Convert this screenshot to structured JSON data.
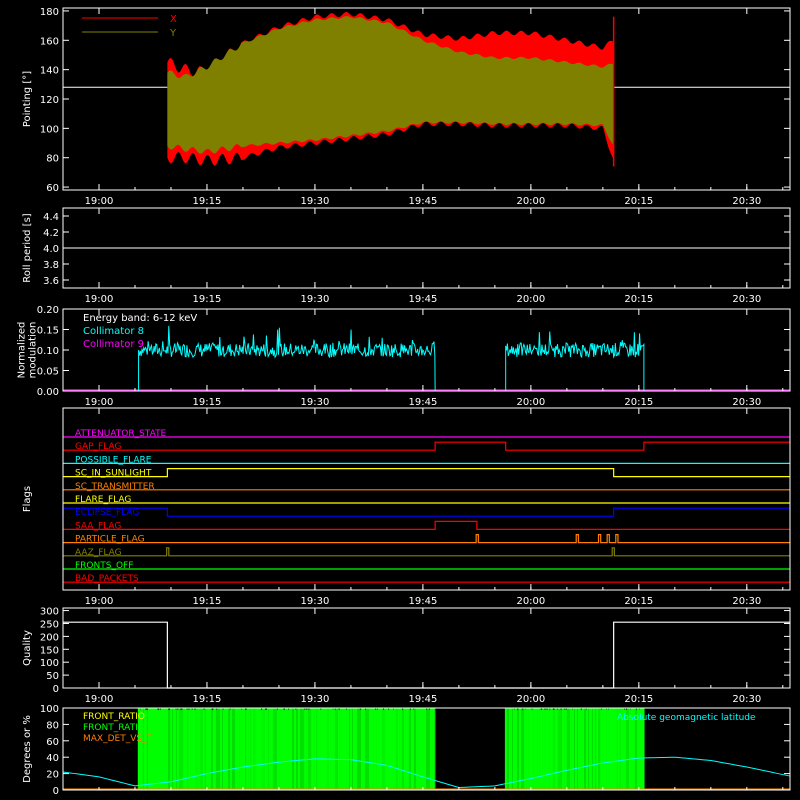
{
  "colors": {
    "background": "#000000",
    "axis": "#ffffff",
    "x_pointing": "#ff0000",
    "y_pointing": "#808000",
    "collimator8": "#00ffff",
    "collimator9": "#ff00ff",
    "magenta": "#ff00ff",
    "red": "#ff0000",
    "cyan": "#00ffff",
    "yellow": "#ffff00",
    "orange": "#ff8000",
    "blue": "#0000ff",
    "olive": "#808000",
    "green": "#00ff00",
    "white": "#ffffff"
  },
  "chart_data": [
    {
      "id": "pointing",
      "type": "area",
      "ylabel": "Pointing [°]",
      "ylim": [
        58,
        182
      ],
      "yticks": [
        60,
        80,
        100,
        120,
        140,
        160,
        180
      ],
      "xlim": [
        1135,
        1236
      ],
      "xticks": [
        "19:00",
        "19:15",
        "19:30",
        "19:45",
        "20:00",
        "20:15",
        "20:30"
      ],
      "xtick_minutes": [
        1140,
        1155,
        1170,
        1185,
        1200,
        1215,
        1230
      ],
      "legend": [
        "X",
        "Y"
      ],
      "reference_line": 128,
      "series": [
        {
          "name": "X",
          "color": "#ff0000",
          "time": [
            1149.5,
            1152,
            1155,
            1160,
            1165,
            1170,
            1175,
            1180,
            1185,
            1190,
            1195,
            1200,
            1205,
            1210,
            1211.5
          ],
          "upper": [
            145,
            140,
            138,
            158,
            169,
            176,
            178,
            174,
            164,
            161,
            165,
            165,
            160,
            155,
            160
          ],
          "lower": [
            80,
            80,
            78,
            80,
            87,
            90,
            93,
            96,
            103,
            103,
            102,
            102,
            102,
            100,
            78
          ]
        },
        {
          "name": "Y",
          "color": "#808000",
          "time": [
            1149.5,
            1152,
            1155,
            1160,
            1165,
            1170,
            1175,
            1180,
            1185,
            1190,
            1195,
            1200,
            1205,
            1210,
            1211.5
          ],
          "upper": [
            138,
            135,
            142,
            158,
            168,
            174,
            176,
            172,
            160,
            152,
            148,
            148,
            145,
            142,
            144
          ],
          "lower": [
            88,
            86,
            84,
            88,
            90,
            92,
            95,
            98,
            104,
            104,
            103,
            103,
            103,
            102,
            88
          ]
        }
      ]
    },
    {
      "id": "roll",
      "type": "line",
      "ylabel": "Roll period [s]",
      "ylim": [
        3.5,
        4.5
      ],
      "yticks": [
        "3.6",
        "3.8",
        "4.0",
        "4.2",
        "4.4"
      ],
      "ytick_values": [
        3.6,
        3.8,
        4.0,
        4.2,
        4.4
      ],
      "xlim": [
        1135,
        1236
      ],
      "xticks": [
        "19:00",
        "19:15",
        "19:30",
        "19:45",
        "20:00",
        "20:15",
        "20:30"
      ],
      "xtick_minutes": [
        1140,
        1155,
        1170,
        1185,
        1200,
        1215,
        1230
      ],
      "value": 4.0
    },
    {
      "id": "modulation",
      "type": "line",
      "ylabel": "Normalized modulation",
      "ylabel_lines": [
        "Normalized",
        "modulation"
      ],
      "ylim": [
        0,
        0.2
      ],
      "yticks": [
        "0.00",
        "0.05",
        "0.10",
        "0.15",
        "0.20"
      ],
      "ytick_values": [
        0,
        0.05,
        0.1,
        0.15,
        0.2
      ],
      "xlim": [
        1135,
        1236
      ],
      "xticks": [
        "19:00",
        "19:15",
        "19:30",
        "19:45",
        "20:00",
        "20:15",
        "20:30"
      ],
      "xtick_minutes": [
        1140,
        1155,
        1170,
        1185,
        1200,
        1215,
        1230
      ],
      "annotation": "Energy band: 6-12 keV",
      "series": [
        {
          "name": "Collimator 8",
          "color": "#00ffff",
          "segments": [
            [
              1145.5,
              1186.7
            ],
            [
              1196.5,
              1215.7
            ]
          ],
          "level": 0.1
        },
        {
          "name": "Collimator 9",
          "color": "#ff00ff",
          "level": 0
        }
      ]
    },
    {
      "id": "flags",
      "type": "line",
      "ylabel": "Flags",
      "xlim": [
        1135,
        1236
      ],
      "xticks": [
        "19:00",
        "19:15",
        "19:30",
        "19:45",
        "20:00",
        "20:15",
        "20:30"
      ],
      "xtick_minutes": [
        1140,
        1155,
        1170,
        1185,
        1200,
        1215,
        1230
      ],
      "series": [
        {
          "name": "ATTENUATOR_STATE",
          "color": "#ff00ff",
          "high": []
        },
        {
          "name": "GAP_FLAG",
          "color": "#ff0000",
          "high": [
            [
              1186.7,
              1196.5
            ],
            [
              1215.7,
              1236
            ]
          ]
        },
        {
          "name": "POSSIBLE_FLARE",
          "color": "#00ffff",
          "high": []
        },
        {
          "name": "SC_IN_SUNLIGHT",
          "color": "#ffff00",
          "high": [
            [
              1149.5,
              1211.5
            ]
          ]
        },
        {
          "name": "SC_TRANSMITTER",
          "color": "#ff8000",
          "high": []
        },
        {
          "name": "FLARE_FLAG",
          "color": "#ffff00",
          "high": []
        },
        {
          "name": "ECLIPSE_FLAG",
          "color": "#0000ff",
          "high": [
            [
              1135,
              1149.5
            ],
            [
              1211.5,
              1236
            ]
          ]
        },
        {
          "name": "SAA_FLAG",
          "color": "#ff0000",
          "high": [
            [
              1186.7,
              1192.5
            ]
          ]
        },
        {
          "name": "PARTICLE_FLAG",
          "color": "#ff8000",
          "high": [
            [
              1192.4,
              1192.7
            ],
            [
              1206.3,
              1206.6
            ],
            [
              1209.4,
              1209.7
            ],
            [
              1210.6,
              1210.9
            ],
            [
              1211.8,
              1212.1
            ]
          ]
        },
        {
          "name": "AAZ_FLAG",
          "color": "#808000",
          "high": [
            [
              1149.4,
              1149.7
            ],
            [
              1211.3,
              1211.6
            ]
          ]
        },
        {
          "name": "FRONTS_OFF",
          "color": "#00ff00",
          "high": []
        },
        {
          "name": "BAD_PACKETS",
          "color": "#ff0000",
          "high": []
        }
      ]
    },
    {
      "id": "quality",
      "type": "line",
      "ylabel": "Quality",
      "ylim": [
        0,
        310
      ],
      "yticks": [
        "0",
        "50",
        "100",
        "150",
        "200",
        "250",
        "300"
      ],
      "ytick_values": [
        0,
        50,
        100,
        150,
        200,
        250,
        300
      ],
      "xlim": [
        1135,
        1236
      ],
      "xticks": [
        "19:00",
        "19:15",
        "19:30",
        "19:45",
        "20:00",
        "20:15",
        "20:30"
      ],
      "xtick_minutes": [
        1140,
        1155,
        1170,
        1185,
        1200,
        1215,
        1230
      ],
      "time": [
        1135,
        1149.5,
        1149.5,
        1211.5,
        1211.5,
        1236
      ],
      "values": [
        255,
        255,
        0,
        0,
        255,
        255
      ]
    },
    {
      "id": "ratios",
      "type": "line",
      "ylabel": "Degrees or %",
      "ylim": [
        0,
        100
      ],
      "yticks": [
        "0",
        "20",
        "40",
        "60",
        "80",
        "100"
      ],
      "ytick_values": [
        0,
        20,
        40,
        60,
        80,
        100
      ],
      "xlim": [
        1135,
        1236
      ],
      "legend": [
        "FRONT_RATIO",
        "FRONT_RATIO_",
        "MAX_DET_VS_T"
      ],
      "legend_colors": [
        "#ffff00",
        "#00ff00",
        "#ff8000"
      ],
      "annotation": "Absolute geomagnetic latitude",
      "green_segments": [
        [
          1145.5,
          1186.7
        ],
        [
          1196.5,
          1215.7
        ]
      ],
      "latitude": {
        "time": [
          1135,
          1140,
          1145,
          1150,
          1155,
          1160,
          1165,
          1170,
          1175,
          1180,
          1185,
          1190,
          1195,
          1200,
          1205,
          1210,
          1215,
          1220,
          1225,
          1230,
          1236
        ],
        "values": [
          22,
          16,
          5,
          10,
          20,
          28,
          34,
          38,
          37,
          30,
          16,
          3,
          5,
          14,
          24,
          33,
          39,
          40,
          36,
          28,
          17
        ]
      }
    }
  ]
}
